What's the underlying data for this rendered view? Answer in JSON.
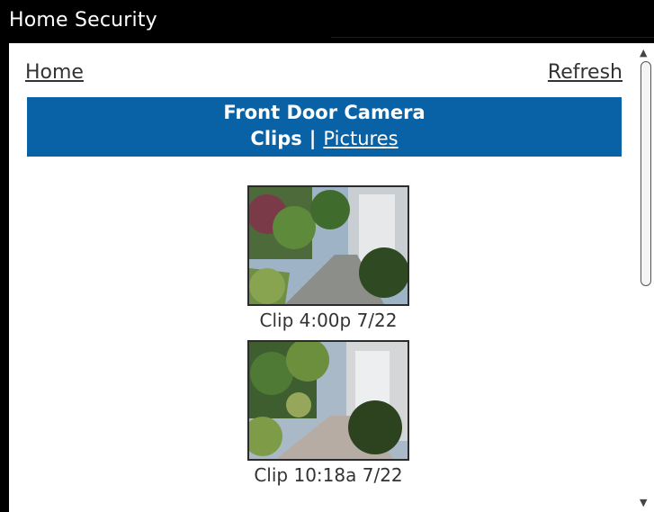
{
  "app": {
    "title": "Home Security"
  },
  "nav": {
    "home_label": "Home",
    "refresh_label": "Refresh"
  },
  "camera": {
    "name": "Front Door Camera",
    "tabs": {
      "clips_label": "Clips",
      "separator": "|",
      "pictures_label": "Pictures"
    }
  },
  "clips": [
    {
      "caption": "Clip 4:00p 7/22"
    },
    {
      "caption": "Clip 10:18a 7/22"
    }
  ],
  "icons": {
    "scroll_up": "chevron-up-icon",
    "scroll_down": "chevron-down-icon"
  },
  "colors": {
    "banner": "#0a62a6",
    "titlebar": "#000000"
  }
}
